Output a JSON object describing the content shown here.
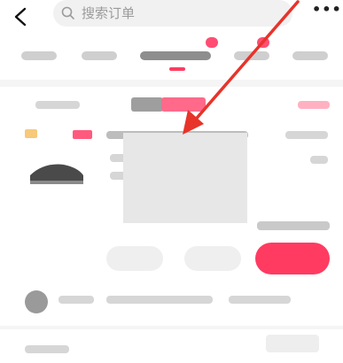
{
  "header": {
    "search_placeholder": "搜索订单",
    "more_glyph": "•••"
  },
  "tabs": {
    "count": 5,
    "active_index": 2
  },
  "colors": {
    "accent": "#ff3b62",
    "annotation_arrow": "#e8332a"
  },
  "icons": {
    "back": "chevron-left-icon",
    "search": "search-icon",
    "more": "more-dots-icon"
  }
}
